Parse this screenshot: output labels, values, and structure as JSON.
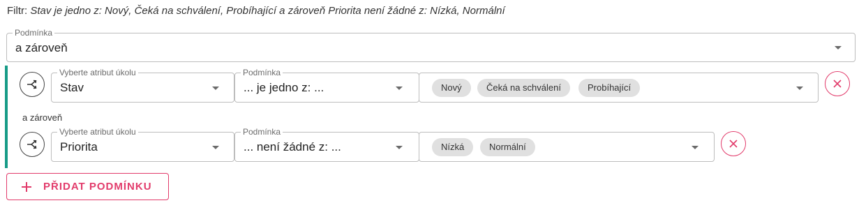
{
  "filter": {
    "prefix": "Filtr: ",
    "description": "Stav je jedno z: Nový, Čeká na schválení, Probíhající a zároveň Priorita není žádné z: Nízká, Normální"
  },
  "top_condition": {
    "label": "Podmínka",
    "value": "a zároveň"
  },
  "rows": [
    {
      "attribute_label": "Vyberte atribut úkolu",
      "attribute_value": "Stav",
      "condition_label": "Podmínka",
      "condition_value": "... je jedno z: ...",
      "chips": [
        "Nový",
        "Čeká na schválení",
        "Probíhající"
      ]
    },
    {
      "attribute_label": "Vyberte atribut úkolu",
      "attribute_value": "Priorita",
      "condition_label": "Podmínka",
      "condition_value": "... není žádné z: ...",
      "chips": [
        "Nízká",
        "Normální"
      ]
    }
  ],
  "conjunction_label": "a zároveň",
  "add_button_label": "PŘIDAT PODMÍNKU",
  "colors": {
    "accent": "#e23b6b",
    "group_bar": "#179b87",
    "chip_bg": "#e0e0e0"
  },
  "icons": {
    "shuffle": "shuffle-icon",
    "remove": "close-icon",
    "dropdown": "chevron-down-icon",
    "add": "plus-icon"
  }
}
